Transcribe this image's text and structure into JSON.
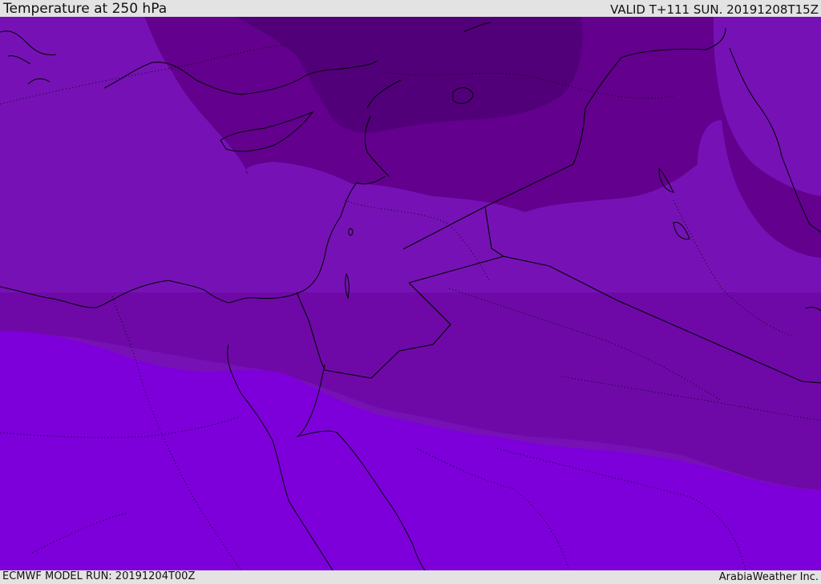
{
  "header": {
    "title": "Temperature at 250 hPa",
    "valid": "VALID T+111 SUN. 20191208T15Z"
  },
  "footer": {
    "model_run": "ECMWF MODEL RUN: 20191204T00Z",
    "credit": "ArabiaWeather Inc."
  },
  "map": {
    "variable": "Temperature",
    "level": "250 hPa",
    "colors": {
      "coldest": "#520079",
      "colder": "#63008e",
      "cold": "#6e09a8",
      "mid": "#7612b5",
      "warm": "#7d00db",
      "borders": "#000000"
    }
  }
}
